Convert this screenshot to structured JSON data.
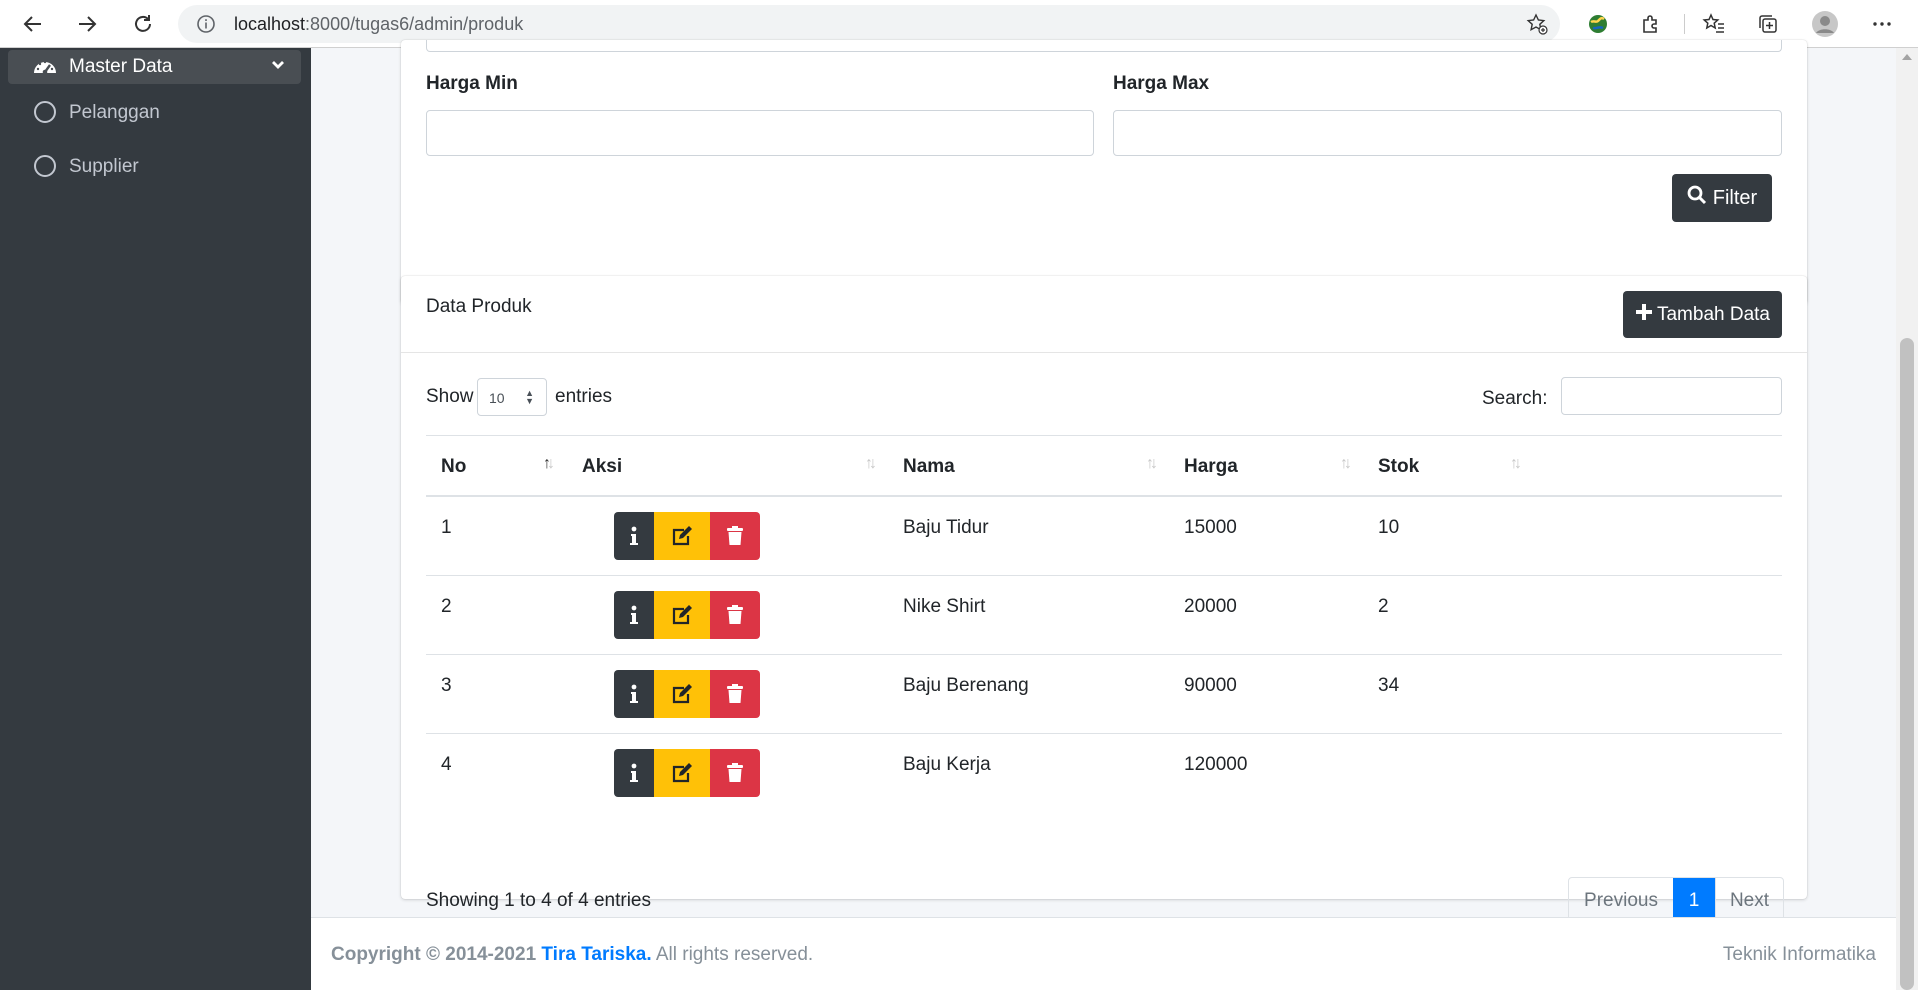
{
  "browser": {
    "url_host": "localhost",
    "url_path": ":8000/tugas6/admin/produk",
    "icons": [
      "back-arrow-icon",
      "forward-arrow-icon",
      "reload-icon",
      "info-icon",
      "favorite-add-icon",
      "earth-extension-icon",
      "extensions-icon",
      "favorites-icon",
      "collections-icon",
      "profile-icon",
      "more-icon"
    ]
  },
  "sidebar": {
    "active_label": "Master Data",
    "items": [
      {
        "label": "Pelanggan"
      },
      {
        "label": "Supplier"
      }
    ]
  },
  "filter": {
    "harga_min_label": "Harga Min",
    "harga_max_label": "Harga Max",
    "harga_min_value": "",
    "harga_max_value": "",
    "filter_button": "Filter"
  },
  "card": {
    "title": "Data Produk",
    "add_button": "Tambah Data"
  },
  "table_controls": {
    "show_label": "Show",
    "length_value": "10",
    "entries_label": "entries",
    "search_label": "Search:",
    "search_value": ""
  },
  "table": {
    "columns": [
      "No",
      "Aksi",
      "Nama",
      "Harga",
      "Stok"
    ],
    "rows": [
      {
        "no": "1",
        "nama": "Baju Tidur",
        "harga": "15000",
        "stok": "10"
      },
      {
        "no": "2",
        "nama": "Nike Shirt",
        "harga": "20000",
        "stok": "2"
      },
      {
        "no": "3",
        "nama": "Baju Berenang",
        "harga": "90000",
        "stok": "34"
      },
      {
        "no": "4",
        "nama": "Baju Kerja",
        "harga": "120000",
        "stok": ""
      }
    ]
  },
  "pagination": {
    "info": "Showing 1 to 4 of 4 entries",
    "previous": "Previous",
    "current": "1",
    "next": "Next"
  },
  "footer": {
    "copyright_prefix": "Copyright © 2014-2021",
    "author": "Tira Tariska.",
    "rights": "All rights reserved.",
    "right_text": "Teknik Informatika"
  },
  "colors": {
    "sidebar_bg": "#343a40",
    "primary": "#007bff",
    "warning": "#ffc107",
    "danger": "#dc3545",
    "dark": "#343a40"
  }
}
